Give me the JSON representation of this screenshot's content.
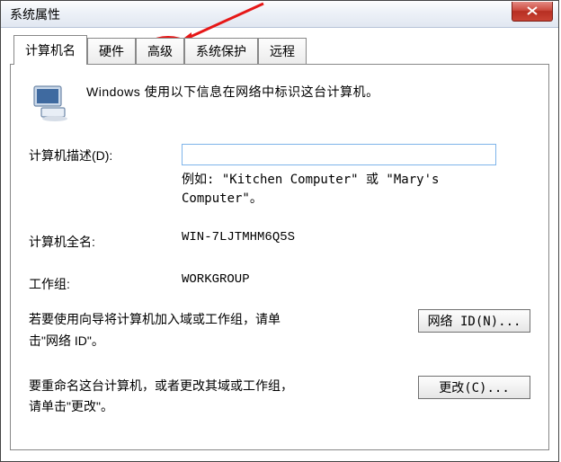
{
  "window": {
    "title": "系统属性"
  },
  "tabs": {
    "computer_name": "计算机名",
    "hardware": "硬件",
    "advanced": "高级",
    "system_protection": "系统保护",
    "remote": "远程"
  },
  "panel": {
    "intro": "Windows 使用以下信息在网络中标识这台计算机。",
    "desc_label": "计算机描述(D):",
    "desc_value": "",
    "desc_hint1": "例如: \"Kitchen Computer\" 或 \"Mary's",
    "desc_hint2": "Computer\"。",
    "fullname_label": "计算机全名:",
    "fullname_value": "WIN-7LJTMHM6Q5S",
    "workgroup_label": "工作组:",
    "workgroup_value": "WORKGROUP",
    "netid_text1": "若要使用向导将计算机加入域或工作组，请单",
    "netid_text2": "击\"网络 ID\"。",
    "netid_button": "网络 ID(N)...",
    "change_text1": "要重命名这台计算机，或者更改其域或工作组，",
    "change_text2": "请单击\"更改\"。",
    "change_button": "更改(C)..."
  }
}
